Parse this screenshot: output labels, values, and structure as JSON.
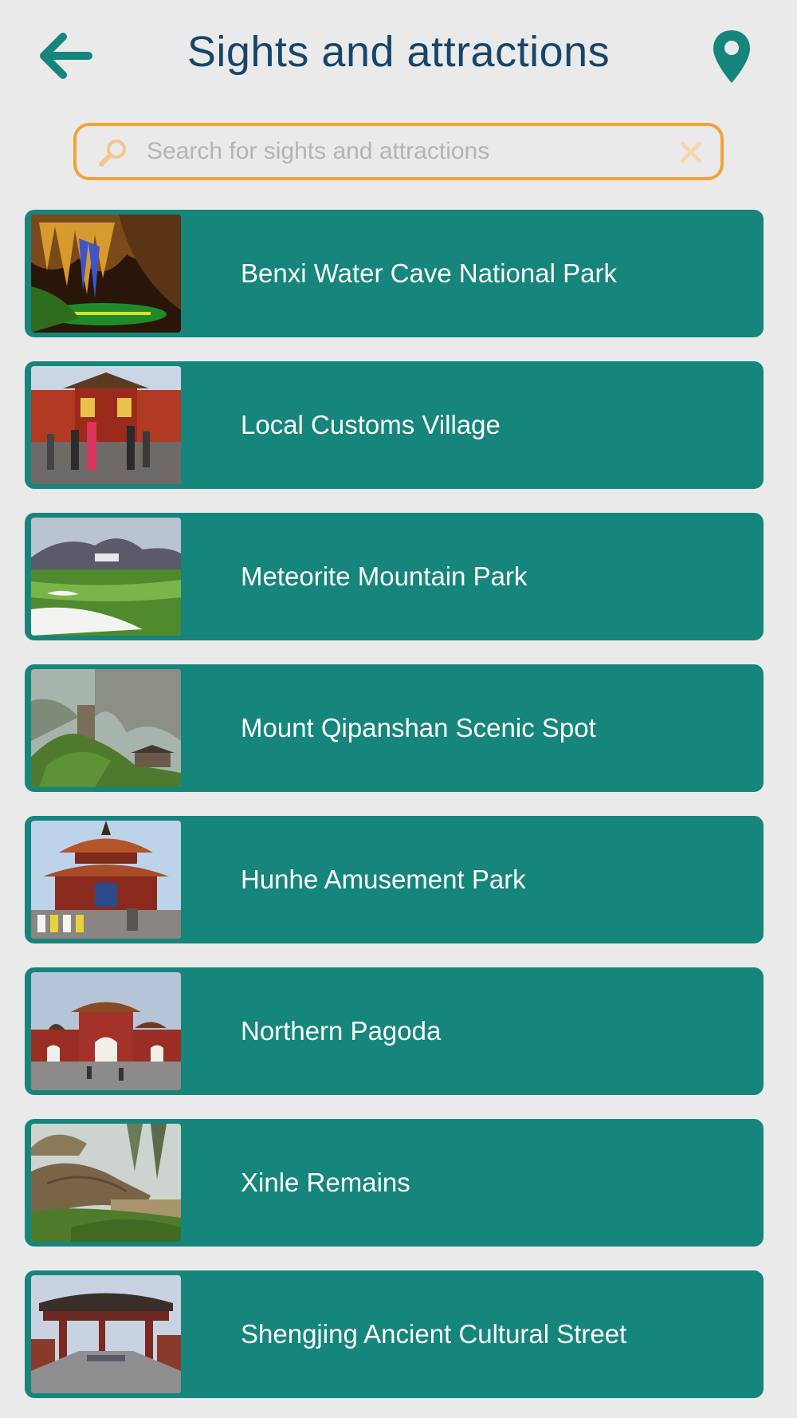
{
  "header": {
    "title": "Sights and attractions",
    "back_icon": "arrow-left-icon",
    "map_icon": "map-pin-icon"
  },
  "search": {
    "placeholder": "Search for sights and attractions",
    "value": "",
    "search_icon": "magnifier-icon",
    "clear_icon": "close-icon"
  },
  "colors": {
    "background": "#ebeaeb",
    "accent": "#16857b",
    "title": "#17466a",
    "search_border": "#f0a33a"
  },
  "items": [
    {
      "label": "Benxi Water Cave National Park",
      "thumbnail": "cave-photo"
    },
    {
      "label": "Local Customs Village",
      "thumbnail": "red-gate-photo"
    },
    {
      "label": "Meteorite Mountain Park",
      "thumbnail": "golf-course-photo"
    },
    {
      "label": "Mount Qipanshan Scenic Spot",
      "thumbnail": "rock-peak-photo"
    },
    {
      "label": "Hunhe Amusement Park",
      "thumbnail": "pagoda-temple-photo"
    },
    {
      "label": "Northern Pagoda",
      "thumbnail": "temple-gate-photo"
    },
    {
      "label": "Xinle Remains",
      "thumbnail": "thatched-hut-photo"
    },
    {
      "label": "Shengjing Ancient Cultural Street",
      "thumbnail": "archway-street-photo"
    }
  ]
}
